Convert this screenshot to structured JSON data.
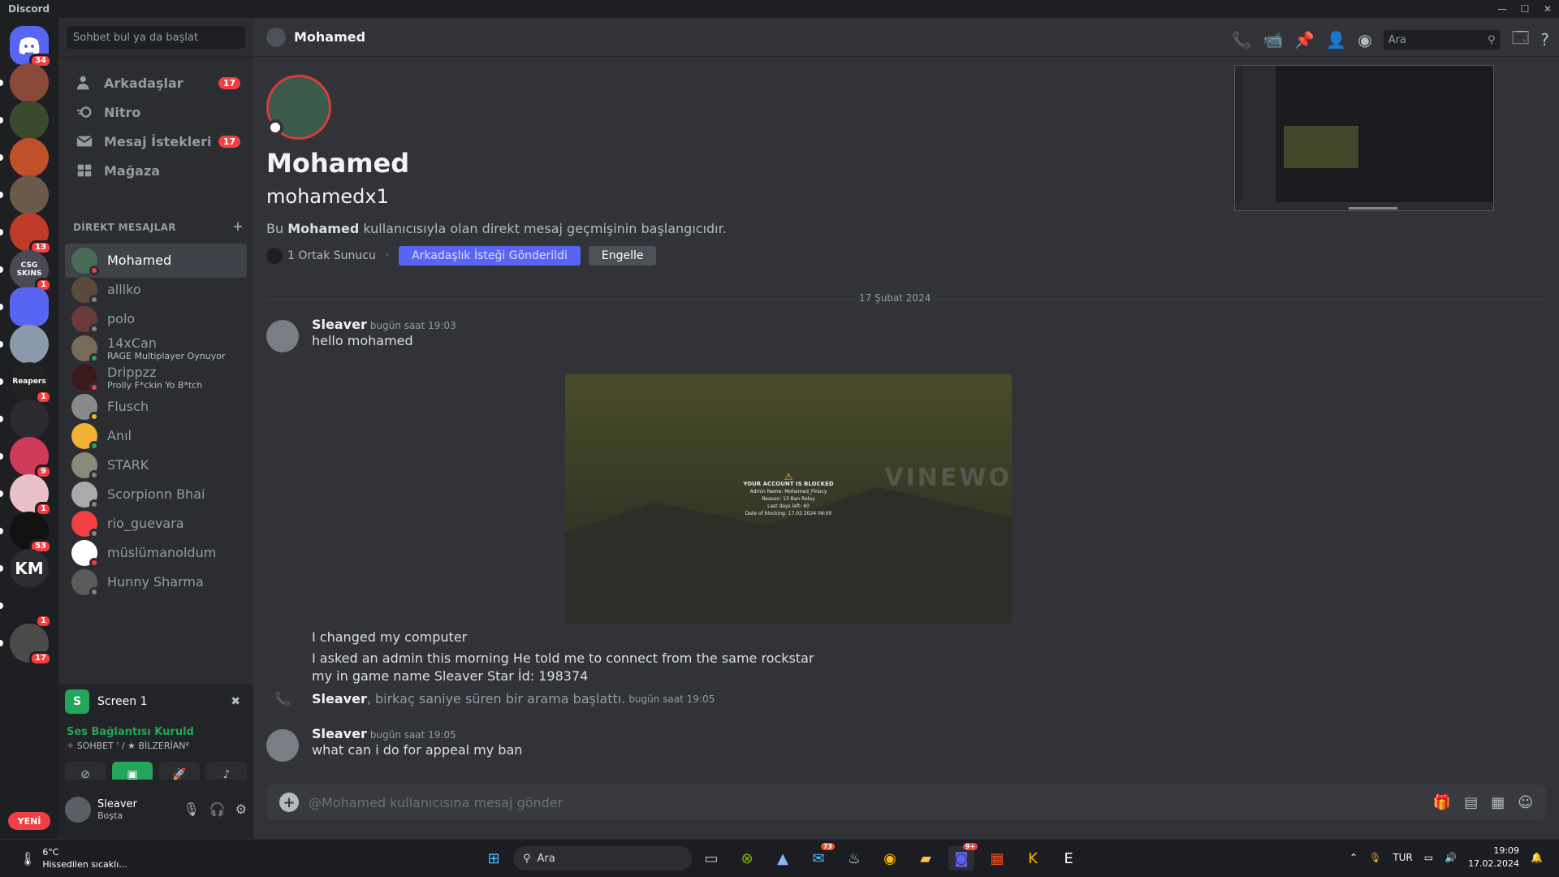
{
  "window": {
    "title": "Discord",
    "min": "—",
    "max": "☐",
    "close": "✕"
  },
  "guilds": [
    {
      "badge": "34",
      "label": ""
    },
    {
      "badge": "",
      "label": ""
    },
    {
      "badge": "",
      "label": ""
    },
    {
      "badge": "",
      "label": ""
    },
    {
      "badge": "",
      "label": ""
    },
    {
      "badge": "13",
      "label": ""
    },
    {
      "badge": "1",
      "label": "CSG SKINS"
    },
    {
      "badge": "",
      "label": ""
    },
    {
      "badge": "",
      "label": ""
    },
    {
      "badge": "1",
      "label": "Reapers"
    },
    {
      "badge": "",
      "label": ""
    },
    {
      "badge": "9",
      "label": ""
    },
    {
      "badge": "1",
      "label": ""
    },
    {
      "badge": "53",
      "label": ""
    },
    {
      "badge": "",
      "label": "KM"
    },
    {
      "badge": "1",
      "label": ""
    },
    {
      "badge": "17",
      "label": ""
    }
  ],
  "guilds_new_label": "YENİ",
  "sidebar": {
    "search_placeholder": "Sohbet bul ya da başlat",
    "nav": [
      {
        "label": "Arkadaşlar",
        "count": "17"
      },
      {
        "label": "Nitro",
        "count": ""
      },
      {
        "label": "Mesaj İstekleri",
        "count": "17"
      },
      {
        "label": "Mağaza",
        "count": ""
      }
    ],
    "dm_header": "DİREKT MESAJLAR",
    "dm_add": "+",
    "dms": [
      {
        "name": "Mohamed",
        "sub": "",
        "color": "#4a6a5a",
        "status": "#f23f43"
      },
      {
        "name": "alllko",
        "sub": "",
        "color": "#5a4a3a",
        "status": "#80848e"
      },
      {
        "name": "polo",
        "sub": "",
        "color": "#6a3a3a",
        "status": "#80848e"
      },
      {
        "name": "14xCan",
        "sub": "RAGE Multiplayer Oynuyor",
        "color": "#7a6a5a",
        "status": "#23a55a"
      },
      {
        "name": "Drippzz",
        "sub": "Prolly F*ckin Yo B*tch",
        "color": "#3a1a1a",
        "status": "#f23f43"
      },
      {
        "name": "Flusch",
        "sub": "",
        "color": "#8a8a8a",
        "status": "#f0b232"
      },
      {
        "name": "Anıl",
        "sub": "",
        "color": "#f0b232",
        "status": "#23a55a"
      },
      {
        "name": "STARK",
        "sub": "",
        "color": "#8a8a7a",
        "status": "#80848e"
      },
      {
        "name": "Scorpionn Bhai",
        "sub": "",
        "color": "#aaaaaa",
        "status": "#80848e"
      },
      {
        "name": "rio_guevara",
        "sub": "",
        "color": "#f23f43",
        "status": "#80848e"
      },
      {
        "name": "müslümanoldum",
        "sub": "",
        "color": "#ffffff",
        "status": "#f23f43"
      },
      {
        "name": "Hunny Sharma",
        "sub": "",
        "color": "#5a5a5a",
        "status": "#80848e"
      }
    ]
  },
  "voice": {
    "screen_label": "Screen 1",
    "screen_letter": "S",
    "connected": "Ses Bağlantısı Kuruld",
    "channel": "✧ SOHBET ' / ★ BİLZERİAN⁸"
  },
  "user": {
    "name": "Sleaver",
    "status": "Boşta"
  },
  "header": {
    "name": "Mohamed",
    "search_placeholder": "Ara"
  },
  "intro": {
    "display_name": "Mohamed",
    "username": "mohamedx1",
    "desc_pre": "Bu ",
    "desc_name": "Mohamed",
    "desc_post": " kullanıcısıyla olan direkt mesaj geçmişinin başlangıcıdır.",
    "mutual": "1 Ortak Sunucu",
    "friend_btn": "Arkadaşlık İsteği Gönderildi",
    "block_btn": "Engelle"
  },
  "date_separator": "17 Şubat 2024",
  "messages": [
    {
      "author": "Sleaver",
      "time": "bugün saat 19:03",
      "lines": [
        "hello mohamed"
      ]
    },
    {
      "lines": [
        "I changed my computer",
        "I asked an admin this morning He told me to connect from the same rockstar",
        "my in game name Sleaver Star İd: 198374"
      ]
    },
    {
      "author": "Sleaver",
      "time": "bugün saat 19:05",
      "lines": [
        "what can i do for appeal my ban"
      ]
    }
  ],
  "image": {
    "title": "YOUR ACCOUNT IS BLOCKED",
    "l1": "Admin Name: Mohamed_Pinocy",
    "l2": "Reason: 13 Ban Relay",
    "l3": "Last days left: 60",
    "l4": "Date of blocking: 17.02.2024 08:00",
    "sign": "VINEWO"
  },
  "call": {
    "who": "Sleaver",
    "rest": ", birkaç saniye süren bir arama başlattı.",
    "time": "bugün saat 19:05"
  },
  "composer": {
    "placeholder": "@Mohamed kullanıcısına mesaj gönder"
  },
  "taskbar": {
    "temp": "6°C",
    "feel": "Hissedilen sıcaklı...",
    "search": "Ara",
    "mail_badge": "73",
    "discord_badge": "9+",
    "lang": "TUR",
    "time": "19:09",
    "date": "17.02.2024"
  }
}
